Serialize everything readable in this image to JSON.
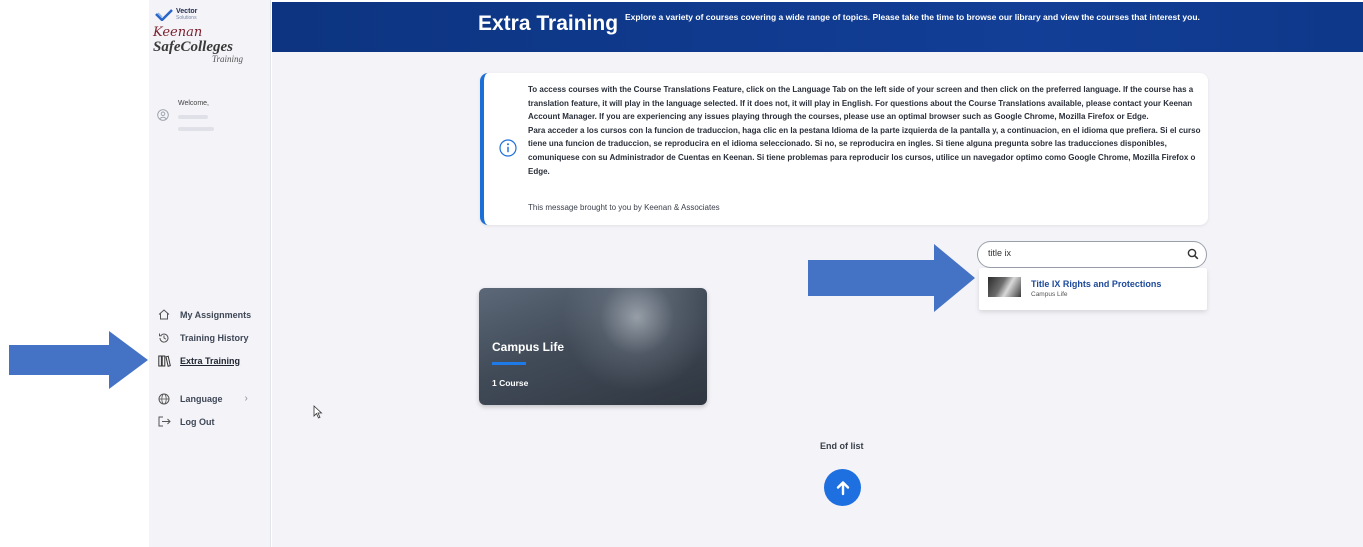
{
  "brand": {
    "vendor": "Vector",
    "vendor_sub": "Solutions",
    "company": "Keenan",
    "product": "SafeColleges",
    "product_sub": "Training"
  },
  "user": {
    "welcome": "Welcome,"
  },
  "nav": {
    "my_assignments": "My Assignments",
    "training_history": "Training History",
    "extra_training": "Extra Training",
    "language": "Language",
    "log_out": "Log Out"
  },
  "header": {
    "title": "Extra Training",
    "description": "Explore a variety of courses covering a wide range of topics. Please take the time to browse our library and view the courses that interest you."
  },
  "notice": {
    "english": "To access courses with the Course Translations Feature, click on the Language Tab on the left side of your screen and then click on the preferred language. If the course has a translation feature, it will play in the language selected. If it does not, it will play in English. For questions about the Course Translations available, please contact your Keenan Account Manager. If you are experiencing any issues playing through the courses, please use an optimal browser such as Google Chrome, Mozilla Firefox or Edge.",
    "spanish": "Para acceder a los cursos con la funcion de traduccion, haga clic en la pestana Idioma de la parte izquierda de la pantalla y, a continuacion, en el idioma que prefiera. Si el curso tiene una funcion de traduccion, se reproducira en el idioma seleccionado. Si no, se reproducira en ingles. Si tiene alguna pregunta sobre las traducciones disponibles, comuniquese con su Administrador de Cuentas en Keenan. Si tiene problemas para reproducir los cursos, utilice un navegador optimo como Google Chrome, Mozilla Firefox o Edge.",
    "signoff": "This message brought to you by Keenan & Associates"
  },
  "search": {
    "value": "title ix",
    "suggestion_title": "Title IX Rights and Protections",
    "suggestion_category": "Campus Life"
  },
  "course_card": {
    "title": "Campus Life",
    "count": "1 Course"
  },
  "footer": {
    "end_text": "End of list"
  },
  "colors": {
    "header_blue": "#0c3480",
    "accent_blue": "#1e6fe0",
    "annotation_arrow": "#4472c4"
  },
  "icons": {
    "home": "home-icon",
    "history": "history-icon",
    "books": "books-icon",
    "globe": "globe-icon",
    "logout": "logout-icon",
    "info": "info-icon",
    "search": "search-icon",
    "up": "arrow-up-icon"
  }
}
